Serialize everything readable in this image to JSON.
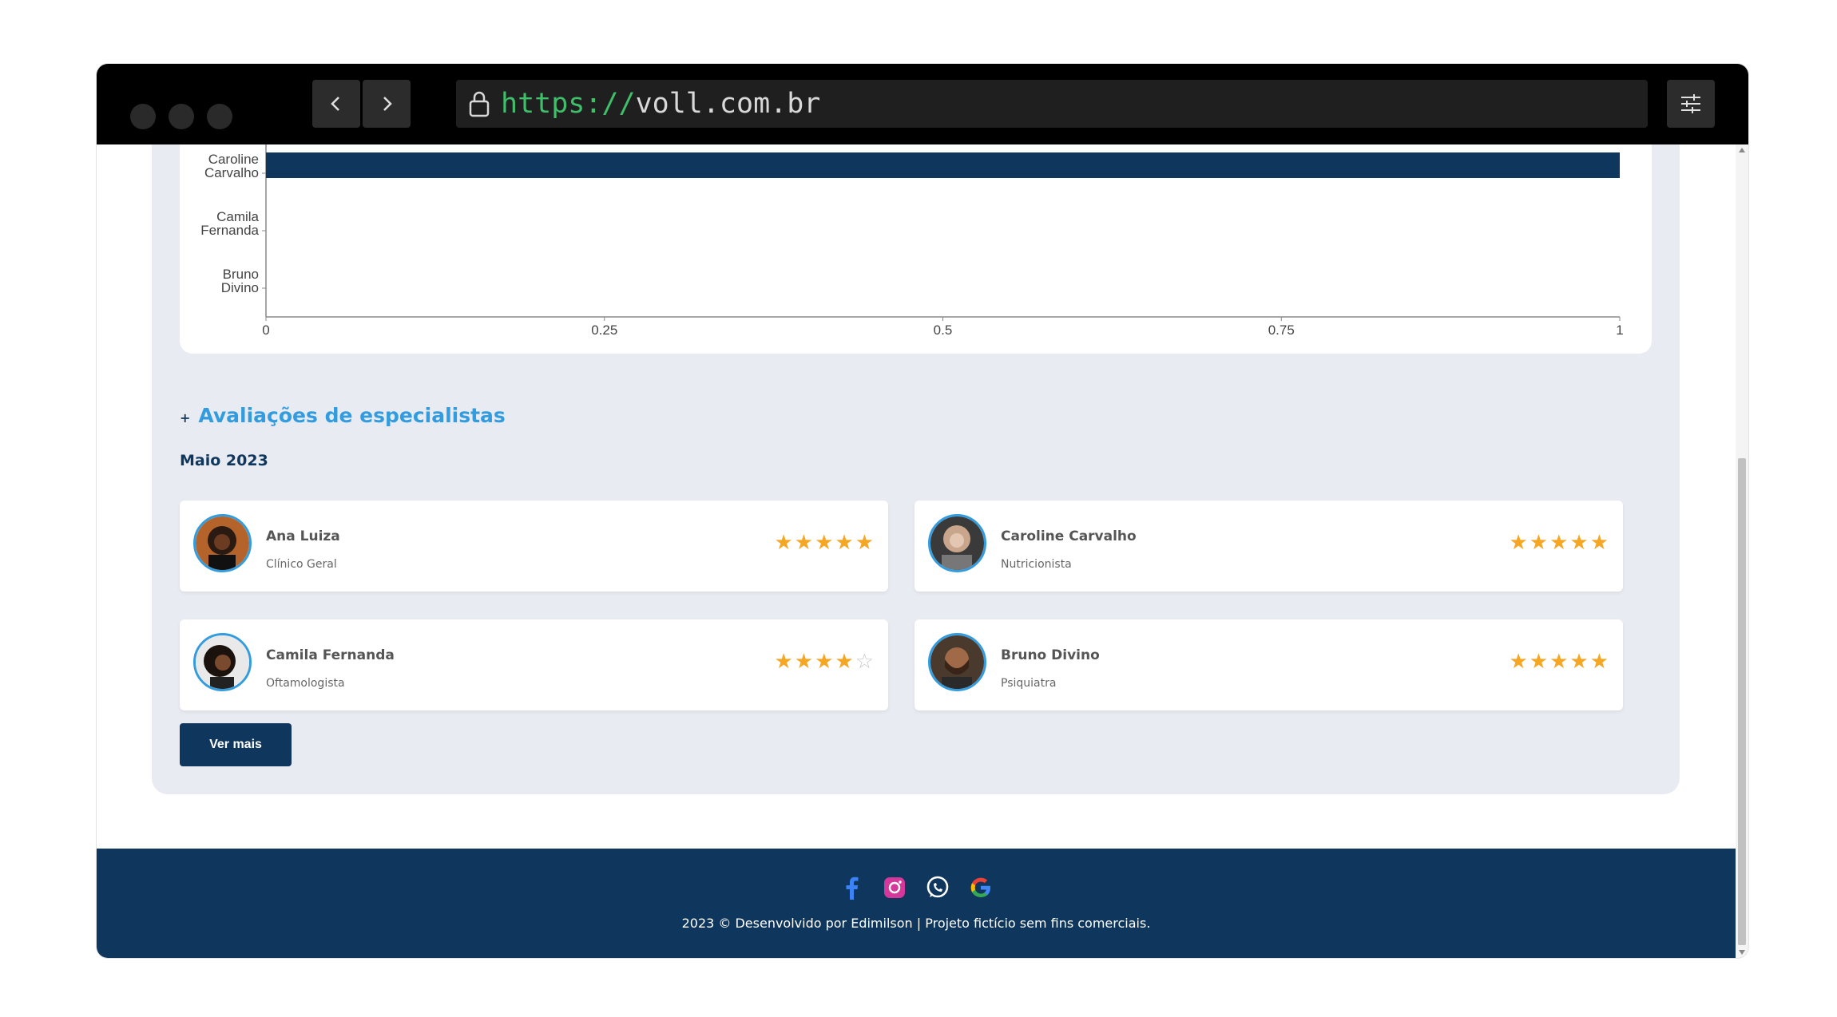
{
  "browser": {
    "url_protocol": "https://",
    "url_host": "voll.com.br"
  },
  "chart_data": {
    "type": "bar",
    "orientation": "horizontal",
    "categories": [
      "Caroline\nCarvalho",
      "Camila\nFernanda",
      "Bruno\nDivino"
    ],
    "category_lines": [
      [
        "Caroline",
        "Carvalho"
      ],
      [
        "Camila",
        "Fernanda"
      ],
      [
        "Bruno",
        "Divino"
      ]
    ],
    "values": [
      1,
      0,
      0
    ],
    "xlim": [
      0,
      1
    ],
    "xticks": [
      "0",
      "0.25",
      "0.5",
      "0.75",
      "1"
    ],
    "bar_color": "#0f365c"
  },
  "reviews": {
    "title_prefix": "+",
    "title": "Avaliações de especialistas",
    "month": "Maio 2023",
    "items": [
      {
        "name": "Ana Luiza",
        "specialty": "Clínico Geral",
        "rating": 5
      },
      {
        "name": "Caroline Carvalho",
        "specialty": "Nutricionista",
        "rating": 5
      },
      {
        "name": "Camila Fernanda",
        "specialty": "Oftamologista",
        "rating": 4
      },
      {
        "name": "Bruno Divino",
        "specialty": "Psiquiatra",
        "rating": 5
      }
    ],
    "more_label": "Ver mais"
  },
  "footer": {
    "icons": [
      "facebook-icon",
      "instagram-icon",
      "whatsapp-icon",
      "google-icon"
    ],
    "text": "2023 © Desenvolvido por Edimilson | Projeto fictício sem fins comerciais."
  },
  "colors": {
    "primary": "#0f365c",
    "accent": "#339cdf",
    "star": "#f5a623"
  }
}
